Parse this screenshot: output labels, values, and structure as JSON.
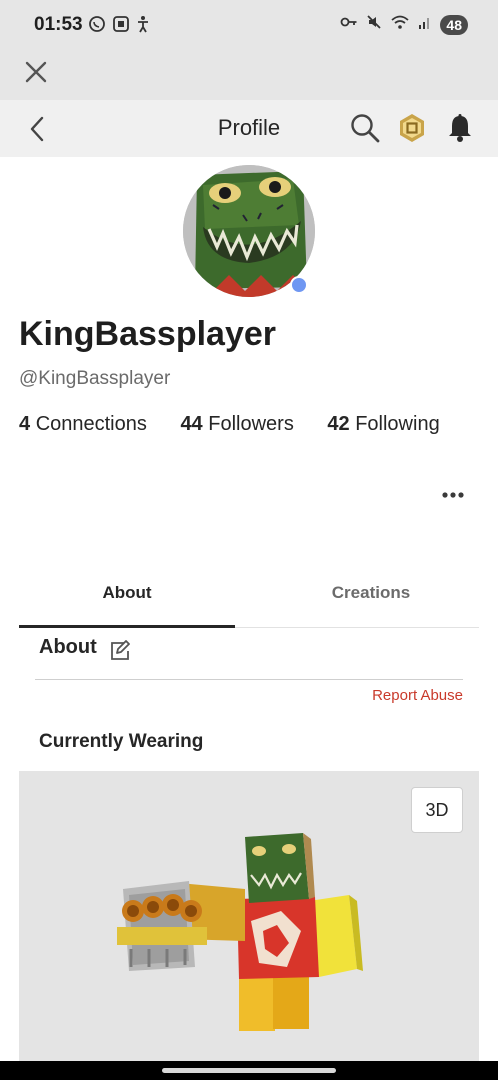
{
  "status_bar": {
    "time": "01:53",
    "left_icons": [
      "whatsapp-icon",
      "screenshot-icon",
      "accessibility-icon"
    ],
    "right_icons": [
      "key-icon",
      "mute-icon",
      "wifi-icon",
      "signal-icon"
    ],
    "battery": "48"
  },
  "header": {
    "title": "Profile"
  },
  "profile": {
    "display_name": "KingBassplayer",
    "username": "@KingBassplayer",
    "online_color": "#6f97f2",
    "stats": [
      {
        "count": "4",
        "label": "Connections"
      },
      {
        "count": "44",
        "label": "Followers"
      },
      {
        "count": "42",
        "label": "Following"
      }
    ]
  },
  "tabs": [
    {
      "label": "About",
      "selected": true
    },
    {
      "label": "Creations",
      "selected": false
    }
  ],
  "about": {
    "heading": "About",
    "report_label": "Report Abuse",
    "report_color": "#c93a2b"
  },
  "wearing": {
    "heading": "Currently Wearing",
    "view_toggle": "3D"
  }
}
